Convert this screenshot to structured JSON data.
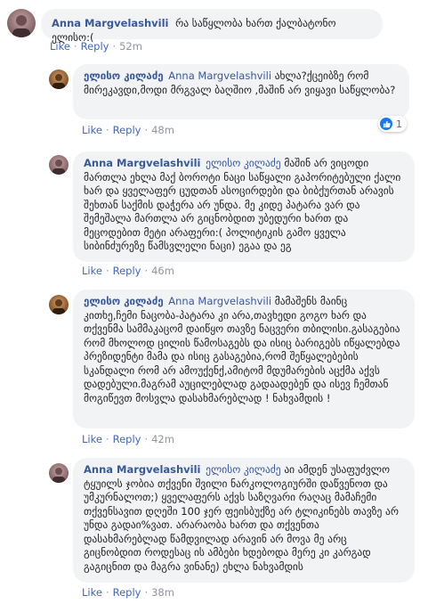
{
  "comments": [
    {
      "author": "Anna Margvelashvili",
      "mention": "",
      "text": "რა საწყლობა ხართ ქალბატონო ელისო:(",
      "like": "Like",
      "reply": "Reply",
      "time": "52m"
    },
    {
      "author": "ელისო კილაძე",
      "mention": "Anna Margvelashvili",
      "text": "ახლა?ქცეიბზე რომ მირეკავდი,მოდი მრგვალ ბაღშიო ,მაშინ არ ვიყავი საწყლობა?",
      "like": "Like",
      "reply": "Reply",
      "time": "48m",
      "reaction_count": "1"
    },
    {
      "author": "Anna Margvelashvili",
      "mention": "ელისო კილაძე",
      "text": "მაშინ არ ვიცოდი მართლა ეხლა მაქ ბოროტი ნაცი საწყალი გაპორიტებული ქალი ხარ და ყველაფერ ცუდთან ასოცირდები და ბიბქურთან არავის შეხთან საქმის დაჭერა არ უნდა. მე კიდე პატარა ვარ და შემეშალა მართლა არ გიცნობდით უბედური ხართ და მეცოდებით მეტი არაფერი:( პოლიტიკის გამო ყველა სიბინძურეზე წამსვლელი ნაცი) ეგაა და ეგ",
      "like": "Like",
      "reply": "Reply",
      "time": "46m"
    },
    {
      "author": "ელისო კილაძე",
      "mention": "Anna Margvelashvili",
      "text": "მამაშენს მაინც კითხე,ჩემი ნაცობა-პატარა კი არა,თავხედი გოგო ხარ და თქვენმა სამმაკაცომ დაიწყო თავზე ნაცვერი თბილისი.გასაგებია რომ მხოლოდ ცილის წამოსაგებს და ისიც ბარიგებს იწყალებდა პრეზიდენტი მამა და ისიც გასაგებია,რომ შეწყალებების სკანდალი რომ არ ამოუქენქ,ამიტომ მდუმარების აცქმა აქვს დადებული.მაგრამ აუცილებლად გადაადებენ და ისევ ჩემთან მოგიწევთ მოსვლა დასახმარებლად ! ნახვამდის !",
      "like": "Like",
      "reply": "Reply",
      "time": "42m"
    },
    {
      "author": "Anna Margvelashvili",
      "mention": "ელისო კილაძე",
      "text": "აი ამდენ უსაფუძვლო ტყუილს ჯობია თქვენი შვილი ნარკოლოგიურში დაწვენოთ და უმკურნალოთ;) ყველაფერს აქვს საზღვარი რაღაც მამაჩემი თქვენსავით დღეში 100 ჯერ ფეისბუქზე არ ტლიკინებს თავზე არ უნდა გადაი%ვათ. არარაობა ხართ და თქვენთა დასახმარებლად წამდვილად არავინ არ მოვა მე არც გიცნობდით როდესაც ის ამბები ხდებოდა მერე კი კარგად გაგიცნით და მაგრა ვინანე) ეხლა ნახვამდის",
      "like": "Like",
      "reply": "Reply",
      "time": "38m"
    }
  ],
  "colors": {
    "link": "#385898",
    "bubble": "#f2f3f5",
    "meta": "#90949c",
    "like_blue": "#1877f2"
  }
}
